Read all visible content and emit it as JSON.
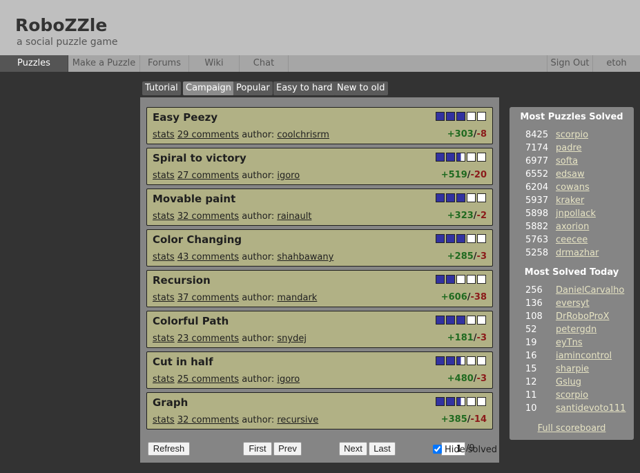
{
  "site": {
    "title": "RoboZZle",
    "subtitle": "a social puzzle game"
  },
  "nav": {
    "left": [
      "Puzzles",
      "Make a Puzzle",
      "Forums",
      "Wiki",
      "Chat"
    ],
    "right": [
      "Sign Out",
      "etoh"
    ],
    "active": "Puzzles"
  },
  "tabs": [
    "Tutorial",
    "Campaign",
    "Popular",
    "Easy to hard",
    "New to old"
  ],
  "active_tab": "Campaign",
  "puzzles": [
    {
      "title": "Easy Peezy",
      "stats": "stats",
      "comments": "29 comments",
      "author_label": "author:",
      "author": "coolchrisrm",
      "plus": "+303",
      "minus": "-8",
      "difficulty": [
        "full",
        "full",
        "full",
        "empty",
        "empty"
      ]
    },
    {
      "title": "Spiral to victory",
      "stats": "stats",
      "comments": "27 comments",
      "author_label": "author:",
      "author": "igoro",
      "plus": "+519",
      "minus": "-20",
      "difficulty": [
        "full",
        "full",
        "half",
        "empty",
        "empty"
      ]
    },
    {
      "title": "Movable paint",
      "stats": "stats",
      "comments": "32 comments",
      "author_label": "author:",
      "author": "rainault",
      "plus": "+323",
      "minus": "-2",
      "difficulty": [
        "full",
        "full",
        "full",
        "empty",
        "empty"
      ]
    },
    {
      "title": "Color Changing",
      "stats": "stats",
      "comments": "43 comments",
      "author_label": "author:",
      "author": "shahbawany",
      "plus": "+285",
      "minus": "-3",
      "difficulty": [
        "full",
        "full",
        "full",
        "empty",
        "empty"
      ]
    },
    {
      "title": "Recursion",
      "stats": "stats",
      "comments": "37 comments",
      "author_label": "author:",
      "author": "mandark",
      "plus": "+606",
      "minus": "-38",
      "difficulty": [
        "full",
        "full",
        "empty",
        "empty",
        "empty"
      ]
    },
    {
      "title": "Colorful Path",
      "stats": "stats",
      "comments": "23 comments",
      "author_label": "author:",
      "author": "snydej",
      "plus": "+181",
      "minus": "-3",
      "difficulty": [
        "full",
        "full",
        "full",
        "empty",
        "empty"
      ]
    },
    {
      "title": "Cut in half",
      "stats": "stats",
      "comments": "25 comments",
      "author_label": "author:",
      "author": "igoro",
      "plus": "+480",
      "minus": "-3",
      "difficulty": [
        "full",
        "full",
        "half",
        "empty",
        "empty"
      ]
    },
    {
      "title": "Graph",
      "stats": "stats",
      "comments": "32 comments",
      "author_label": "author:",
      "author": "recursive",
      "plus": "+385",
      "minus": "-14",
      "difficulty": [
        "full",
        "full",
        "half",
        "empty",
        "empty"
      ]
    }
  ],
  "pager": {
    "refresh": "Refresh",
    "first": "First",
    "prev": "Prev",
    "page": "1",
    "total": "/9",
    "next": "Next",
    "last": "Last",
    "hide_solved": "Hide solved",
    "hide_solved_checked": true
  },
  "sidebar": {
    "most_title": "Most Puzzles Solved",
    "most": [
      {
        "count": "8425",
        "user": "scorpio"
      },
      {
        "count": "7174",
        "user": "padre"
      },
      {
        "count": "6977",
        "user": "softa"
      },
      {
        "count": "6552",
        "user": "edsaw"
      },
      {
        "count": "6204",
        "user": "cowans"
      },
      {
        "count": "5937",
        "user": "kraker"
      },
      {
        "count": "5898",
        "user": "jnpollack"
      },
      {
        "count": "5882",
        "user": "axorion"
      },
      {
        "count": "5763",
        "user": "ceecee"
      },
      {
        "count": "5258",
        "user": "drmazhar"
      }
    ],
    "today_title": "Most Solved Today",
    "today": [
      {
        "count": "256",
        "user": "DanielCarvalho"
      },
      {
        "count": "136",
        "user": "eversyt"
      },
      {
        "count": "108",
        "user": "DrRoboProX"
      },
      {
        "count": "52",
        "user": "petergdn"
      },
      {
        "count": "19",
        "user": "eyTns"
      },
      {
        "count": "16",
        "user": "iamincontrol"
      },
      {
        "count": "15",
        "user": "sharpie"
      },
      {
        "count": "12",
        "user": "Gslug"
      },
      {
        "count": "11",
        "user": "scorpio"
      },
      {
        "count": "10",
        "user": "santidevoto111"
      }
    ],
    "full_scoreboard": "Full scoreboard"
  },
  "colors": {
    "card_bg": "#b1b185",
    "plus": "#206a20",
    "minus": "#8b1a1a",
    "difficulty_fill": "#3232a0",
    "link_light": "#e6e3c3"
  }
}
